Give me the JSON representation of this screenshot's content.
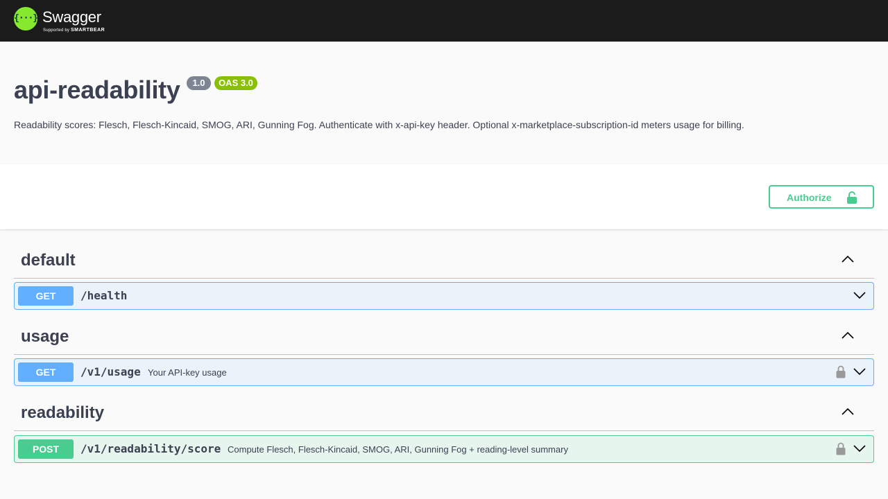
{
  "topbar": {
    "logo_name": "Swagger",
    "logo_sub_prefix": "Supported by",
    "logo_sub_brand": "SMARTBEAR"
  },
  "info": {
    "title": "api-readability",
    "version": "1.0",
    "oas": "OAS 3.0",
    "description": "Readability scores: Flesch, Flesch-Kincaid, SMOG, ARI, Gunning Fog. Authenticate with x-api-key header. Optional x-marketplace-subscription-id meters usage for billing."
  },
  "auth": {
    "label": "Authorize"
  },
  "tags": [
    {
      "name": "default",
      "operations": [
        {
          "method": "GET",
          "path": "/health",
          "summary": "",
          "locked": false
        }
      ]
    },
    {
      "name": "usage",
      "operations": [
        {
          "method": "GET",
          "path": "/v1/usage",
          "summary": "Your API-key usage",
          "locked": true
        }
      ]
    },
    {
      "name": "readability",
      "operations": [
        {
          "method": "POST",
          "path": "/v1/readability/score",
          "summary": "Compute Flesch, Flesch-Kincaid, SMOG, ARI, Gunning Fog + reading-level summary",
          "locked": true
        }
      ]
    }
  ],
  "colors": {
    "topbar": "#1b1b1b",
    "logo_green": "#85ea2d",
    "get": "#61affe",
    "post": "#49cc90",
    "text": "#3b4151",
    "version_badge": "#7d8492",
    "oas_badge": "#89bf04"
  },
  "icons": {
    "logo": "swagger-logo-icon",
    "lock": "lock-icon",
    "chevron_up": "chevron-up-icon",
    "chevron_down": "chevron-down-icon"
  }
}
